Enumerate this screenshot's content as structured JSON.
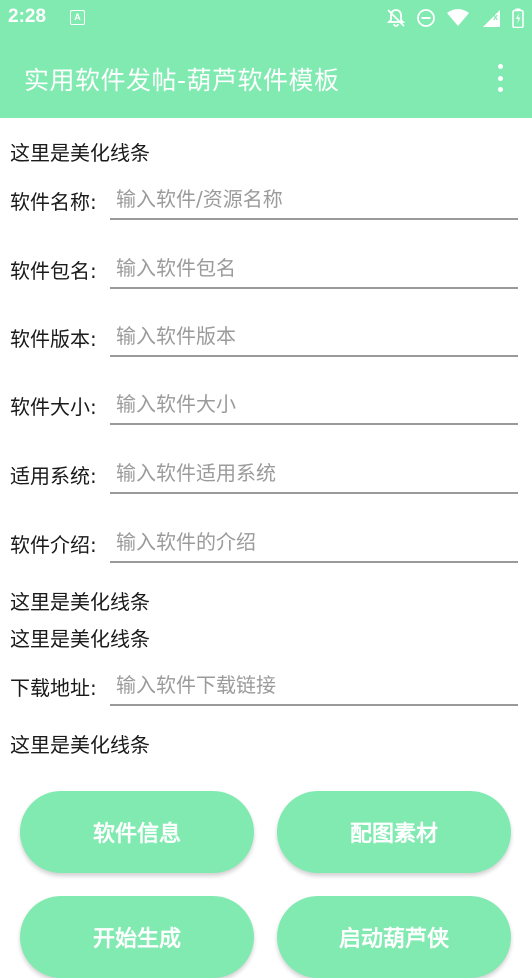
{
  "status_bar": {
    "time": "2:28",
    "notification_icon": "A",
    "icons": [
      "bell-off-icon",
      "do-not-disturb-icon",
      "wifi-icon",
      "cell-signal-icon",
      "battery-icon"
    ]
  },
  "app_bar": {
    "title": "实用软件发帖-葫芦软件模板",
    "menu_icon": "more-vertical-icon"
  },
  "decor_line_text": "这里是美化线条",
  "form": {
    "fields": [
      {
        "label": "软件名称:",
        "placeholder": "输入软件/资源名称",
        "value": ""
      },
      {
        "label": "软件包名:",
        "placeholder": "输入软件包名",
        "value": ""
      },
      {
        "label": "软件版本:",
        "placeholder": "输入软件版本",
        "value": ""
      },
      {
        "label": "软件大小:",
        "placeholder": "输入软件大小",
        "value": ""
      },
      {
        "label": "适用系统:",
        "placeholder": "输入软件适用系统",
        "value": ""
      },
      {
        "label": "软件介绍:",
        "placeholder": "输入软件的介绍",
        "value": ""
      }
    ],
    "download": {
      "label": "下载地址:",
      "placeholder": "输入软件下载链接",
      "value": ""
    }
  },
  "buttons": {
    "info": "软件信息",
    "images": "配图素材",
    "generate": "开始生成",
    "launch": "启动葫芦侠"
  },
  "colors": {
    "accent": "#80eab1",
    "underline": "#9a9a9a",
    "placeholder": "#9b9b9b"
  }
}
